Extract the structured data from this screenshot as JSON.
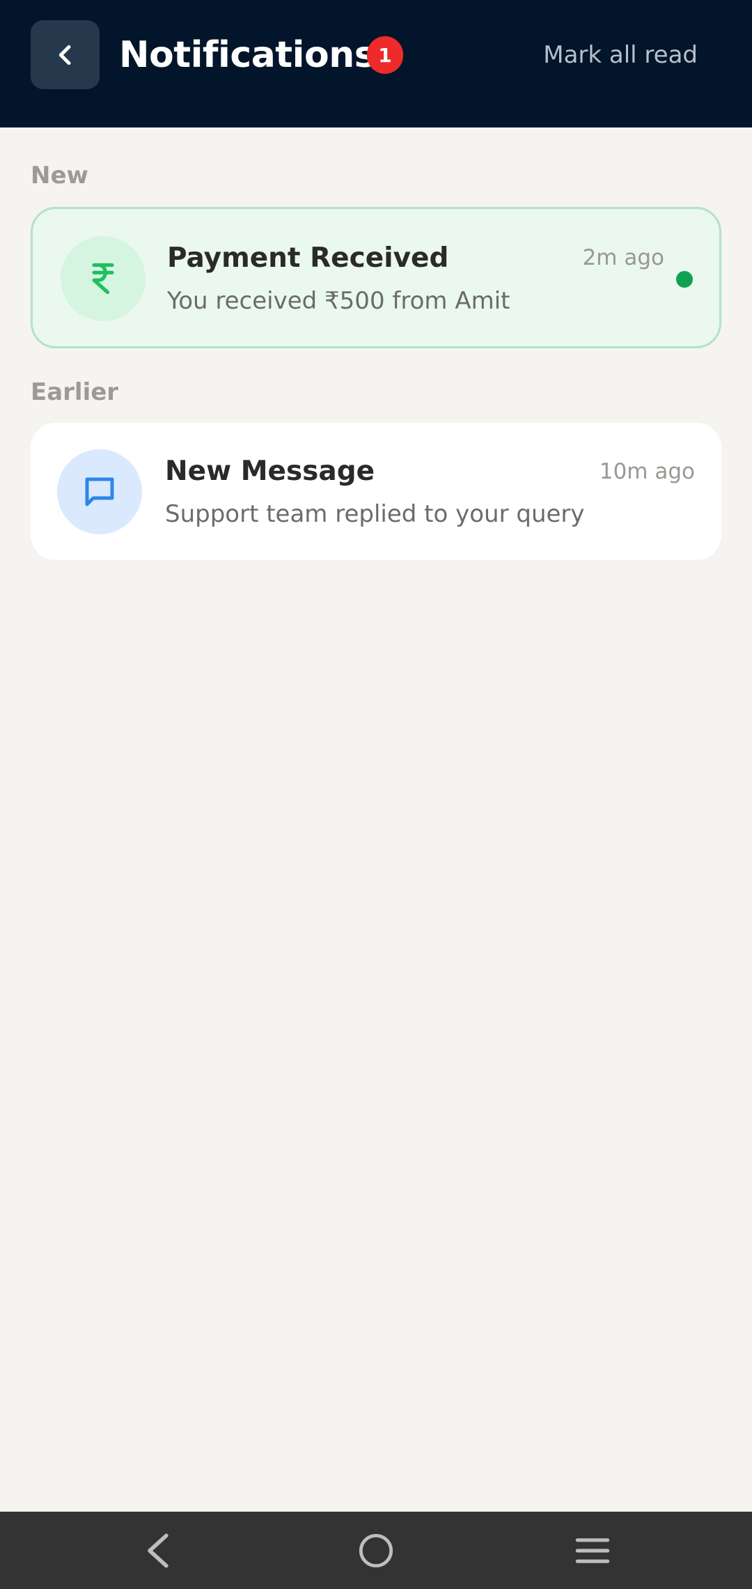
{
  "header": {
    "title": "Notifications",
    "unread_count": "1",
    "mark_all_read": "Mark all read",
    "back_icon": "chevron-left-icon"
  },
  "sections": {
    "new_label": "New",
    "earlier_label": "Earlier"
  },
  "notifications": [
    {
      "title": "Payment Received",
      "body": "You received ₹500 from Amit",
      "time": "2m ago",
      "icon": "rupee-icon",
      "unread": true
    },
    {
      "title": "New Message",
      "body": "Support team replied to your query",
      "time": "10m ago",
      "icon": "chat-bubble-icon",
      "unread": false
    }
  ],
  "navbar": {
    "back_icon": "nav-back-icon",
    "home_icon": "nav-home-icon",
    "menu_icon": "nav-menu-icon"
  },
  "colors": {
    "header_bg": "#02152a",
    "badge": "#ee2a2a",
    "unread_dot": "#12a154",
    "rupee_green": "#1fbf60",
    "chat_blue": "#2d87e8"
  }
}
